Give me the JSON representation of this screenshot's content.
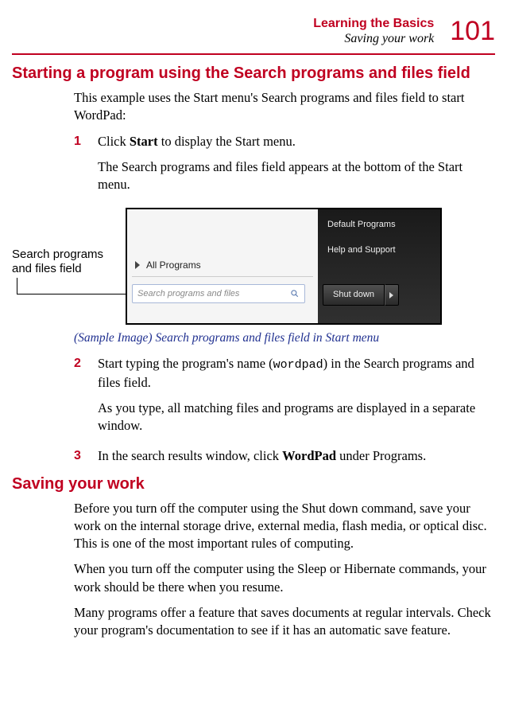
{
  "header": {
    "chapter": "Learning the Basics",
    "section": "Saving your work",
    "page": "101"
  },
  "sections": {
    "starting": {
      "heading": "Starting a program using the Search programs and files field",
      "intro": "This example uses the Start menu's Search programs and files field to start WordPad:",
      "steps": [
        {
          "num": "1",
          "pre": "Click ",
          "bold": "Start",
          "post": " to display the Start menu.",
          "after": "The Search programs and files field appears at the bottom of the Start menu."
        },
        {
          "num": "2",
          "pre": "Start typing the program's name (",
          "code": "wordpad",
          "post": ") in the Search programs and files field.",
          "after": "As you type, all matching files and programs are displayed in a separate window."
        },
        {
          "num": "3",
          "pre": "In the search results window, click ",
          "bold": "WordPad",
          "post": " under Programs."
        }
      ],
      "figure": {
        "callout": "Search programs and files field",
        "allprograms": "All Programs",
        "search_placeholder": "Search programs and files",
        "default_programs": "Default Programs",
        "help_support": "Help and Support",
        "shutdown": "Shut down",
        "caption": "(Sample Image) Search programs and files field in Start menu"
      }
    },
    "saving": {
      "heading": "Saving your work",
      "paras": [
        "Before you turn off the computer using the Shut down command, save your work on the internal storage drive, external media, flash media, or optical disc. This is one of the most important rules of computing.",
        "When you turn off the computer using the Sleep or Hibernate commands, your work should be there when you resume.",
        "Many programs offer a feature that saves documents at regular intervals. Check your program's documentation to see if it has an automatic save feature."
      ]
    }
  }
}
